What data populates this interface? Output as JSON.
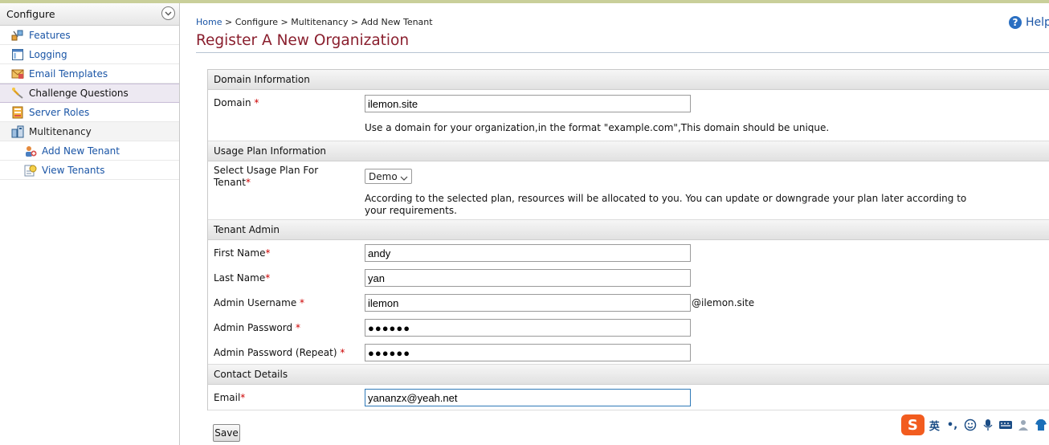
{
  "sidebar": {
    "title": "Configure",
    "items": [
      {
        "label": "Features",
        "icon": "features-icon"
      },
      {
        "label": "Logging",
        "icon": "logging-icon"
      },
      {
        "label": "Email Templates",
        "icon": "email-templates-icon"
      },
      {
        "label": "Challenge Questions",
        "icon": "challenge-questions-icon"
      },
      {
        "label": "Server Roles",
        "icon": "server-roles-icon"
      },
      {
        "label": "Multitenancy",
        "icon": "multitenancy-icon"
      },
      {
        "label": "Add New Tenant",
        "icon": "add-tenant-icon"
      },
      {
        "label": "View Tenants",
        "icon": "view-tenants-icon"
      }
    ]
  },
  "breadcrumb": {
    "home": "Home",
    "sep": " > ",
    "configure": "Configure",
    "multitenancy": "Multitenancy",
    "current": "Add New Tenant"
  },
  "help": {
    "label": "Help"
  },
  "page": {
    "title": "Register A New Organization"
  },
  "sections": {
    "domain": "Domain Information",
    "usage": "Usage Plan Information",
    "admin": "Tenant Admin",
    "contact": "Contact Details"
  },
  "fields": {
    "domain": {
      "label": "Domain ",
      "required": "*",
      "value": "ilemon.site",
      "hint": "Use a domain for your organization,in the format \"example.com\",This domain should be unique."
    },
    "usage_plan": {
      "label_line1": "Select Usage Plan For",
      "label_line2": "Tenant",
      "required": "*",
      "value": "Demo",
      "hint": "According to the selected plan, resources will be allocated to you. You can update or downgrade your plan later according to your requirements."
    },
    "first_name": {
      "label": "First Name",
      "required": "*",
      "value": "andy"
    },
    "last_name": {
      "label": "Last Name",
      "required": "*",
      "value": "yan"
    },
    "admin_username": {
      "label": "Admin Username ",
      "required": "*",
      "value": "ilemon",
      "suffix": "@ilemon.site"
    },
    "admin_password": {
      "label": "Admin Password ",
      "required": "*",
      "value": "●●●●●●"
    },
    "admin_password_repeat": {
      "label": "Admin Password (Repeat) ",
      "required": "*",
      "value": "●●●●●●"
    },
    "email": {
      "label": "Email",
      "required": "*",
      "value": "yananzx@yeah.net"
    }
  },
  "buttons": {
    "save": "Save"
  },
  "ime": {
    "logo": "S",
    "lang": "英",
    "punct": "•,"
  },
  "colors": {
    "title": "#8a1f2e",
    "link": "#1a55a6",
    "required": "#cc0000",
    "ime_logo": "#f25c1f"
  }
}
